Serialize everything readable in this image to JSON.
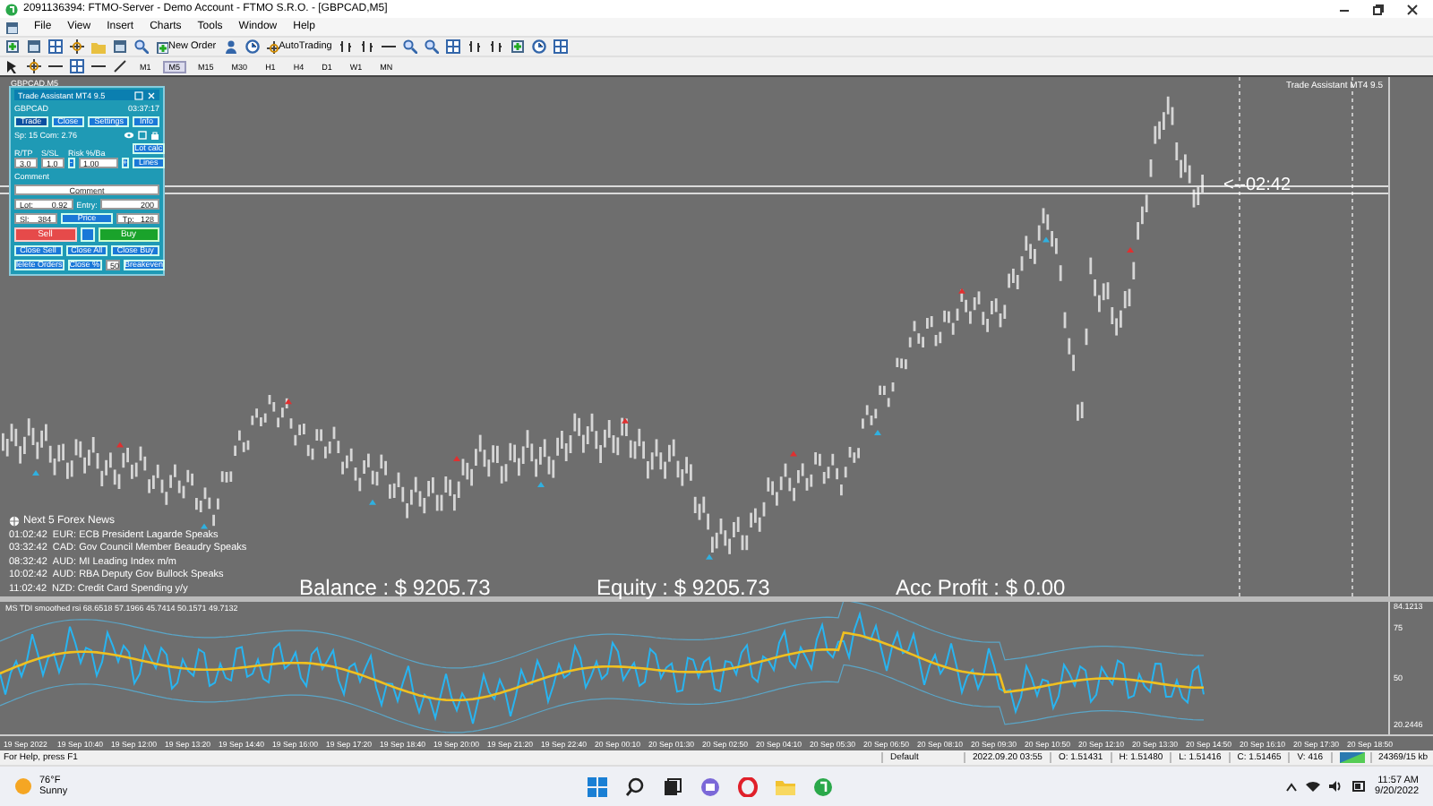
{
  "window": {
    "title": "2091136394: FTMO-Server - Demo Account - FTMO S.R.O. - [GBPCAD,M5]"
  },
  "menu": [
    "File",
    "View",
    "Insert",
    "Charts",
    "Tools",
    "Window",
    "Help"
  ],
  "toolbar": {
    "new_order": "New Order",
    "auto_trading": "AutoTrading"
  },
  "timeframes": [
    {
      "label": "M1",
      "selected": false
    },
    {
      "label": "M5",
      "selected": true
    },
    {
      "label": "M15",
      "selected": false
    },
    {
      "label": "M30",
      "selected": false
    },
    {
      "label": "H1",
      "selected": false
    },
    {
      "label": "H4",
      "selected": false
    },
    {
      "label": "D1",
      "selected": false
    },
    {
      "label": "W1",
      "selected": false
    },
    {
      "label": "MN",
      "selected": false
    }
  ],
  "chart": {
    "symbol": "GBPCAD,M5",
    "expert_label": "Trade Assistant MT4 9.5",
    "countdown": "<--02:42",
    "news": {
      "title": "Next 5 Forex News",
      "items": [
        {
          "time": "01:02:42",
          "event": "EUR: ECB President Lagarde Speaks"
        },
        {
          "time": "03:32:42",
          "event": "CAD: Gov Council Member Beaudry Speaks"
        },
        {
          "time": "08:32:42",
          "event": "AUD: MI Leading Index m/m"
        },
        {
          "time": "10:02:42",
          "event": "AUD: RBA Deputy Gov Bullock Speaks"
        },
        {
          "time": "11:02:42",
          "event": "NZD: Credit Card Spending y/y"
        }
      ]
    },
    "account": [
      "Balance : $ 9205.73",
      "Equity : $ 9205.73",
      "Acc Profit : $ 0.00"
    ]
  },
  "panel": {
    "title": "Trade Assistant MT4 9.5",
    "symbol": "GBPCAD",
    "clock": "03:37:17",
    "tabs": [
      {
        "label": "Trade",
        "selected": true
      },
      {
        "label": "Close",
        "selected": false
      },
      {
        "label": "Settings",
        "selected": false
      },
      {
        "label": "Info",
        "selected": false
      }
    ],
    "spread": "Sp: 15  Com: 2.76",
    "params": [
      {
        "label": "R/TP",
        "value": "3.0"
      },
      {
        "label": "S/SL",
        "value": "1.0"
      },
      {
        "label": "Risk %/Ba",
        "value": "1.00"
      }
    ],
    "minus": "-",
    "plus": "+",
    "lot_calc": "Lot calc",
    "lines": "Lines",
    "comment_label": "Comment",
    "comment": "Comment",
    "lot": {
      "label": "Lot:",
      "value": "0.92"
    },
    "entry": {
      "label": "Entry:",
      "value": "200"
    },
    "sl": {
      "label": "Sl:",
      "value": "384"
    },
    "price": "Price",
    "tp": {
      "label": "Tp:",
      "value": "128"
    },
    "sell": "Sell",
    "buy": "Buy",
    "close_buttons": [
      "Close Sell",
      "Close All",
      "Close Buy"
    ],
    "bottom": {
      "delete": "lelete Orders",
      "close_pct": "Close %",
      "pct": "50",
      "breakeven": "Breakeven"
    }
  },
  "indicator": {
    "label": "MS TDI smoothed rsi 68.6518 57.1966 45.7414 50.1571 49.7132",
    "scale": [
      "84.1213",
      "75",
      "50",
      "20.2446"
    ]
  },
  "time_axis": [
    "19 Sep 2022",
    "19 Sep 10:40",
    "19 Sep 12:00",
    "19 Sep 13:20",
    "19 Sep 14:40",
    "19 Sep 16:00",
    "19 Sep 17:20",
    "19 Sep 18:40",
    "19 Sep 20:00",
    "19 Sep 21:20",
    "19 Sep 22:40",
    "20 Sep 00:10",
    "20 Sep 01:30",
    "20 Sep 02:50",
    "20 Sep 04:10",
    "20 Sep 05:30",
    "20 Sep 06:50",
    "20 Sep 08:10",
    "20 Sep 09:30",
    "20 Sep 10:50",
    "20 Sep 12:10",
    "20 Sep 13:30",
    "20 Sep 14:50",
    "20 Sep 16:10",
    "20 Sep 17:30",
    "20 Sep 18:50"
  ],
  "status_bar": {
    "help": "For Help, press F1",
    "profile": "Default",
    "fields": [
      "2022.09.20 03:55",
      "O: 1.51431",
      "H: 1.51480",
      "L: 1.51416",
      "C: 1.51465",
      "V: 416"
    ],
    "traffic": "24369/15 kb"
  },
  "taskbar": {
    "temperature": "76°F",
    "weather": "Sunny",
    "time": "11:57 AM",
    "date": "9/20/2022"
  }
}
